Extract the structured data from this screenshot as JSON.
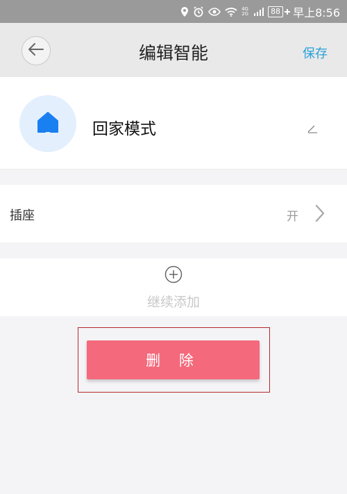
{
  "status_bar": {
    "network_top": "4G",
    "network_bottom": "2G",
    "battery": "88",
    "time": "早上8:56"
  },
  "header": {
    "title": "编辑智能",
    "save_label": "保存"
  },
  "scene": {
    "name": "回家模式",
    "icon": "home-icon",
    "accent_color": "#1a7ff0"
  },
  "devices": [
    {
      "name": "插座",
      "state": "开"
    }
  ],
  "add": {
    "label": "继续添加"
  },
  "delete": {
    "label": "删 除",
    "color": "#f4697b"
  }
}
